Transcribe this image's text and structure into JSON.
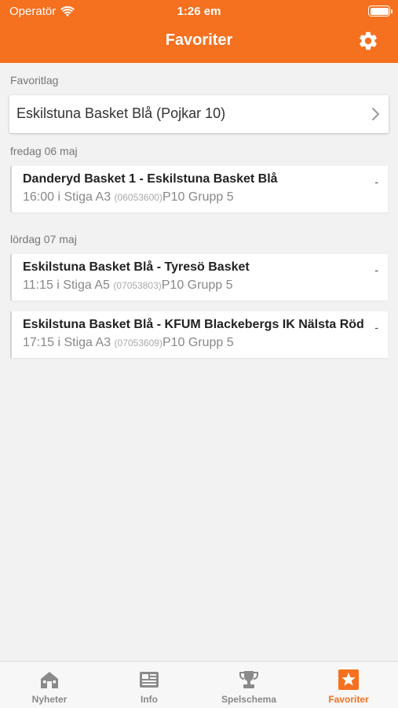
{
  "status_bar": {
    "carrier": "Operatör",
    "time": "1:26 em"
  },
  "header": {
    "title": "Favoriter"
  },
  "favorites": {
    "section_label": "Favoritlag",
    "team": "Eskilstuna Basket Blå (Pojkar 10)"
  },
  "days": [
    {
      "label": "fredag 06 maj",
      "matches": [
        {
          "teams": "Danderyd Basket 1 - Eskilstuna Basket Blå",
          "time_place": "16:00 i Stiga A3",
          "code": "(06053600)",
          "group": "P10 Grupp 5",
          "score": "-"
        }
      ]
    },
    {
      "label": "lördag 07 maj",
      "matches": [
        {
          "teams": "Eskilstuna Basket Blå - Tyresö Basket",
          "time_place": "11:15 i Stiga A5",
          "code": "(07053803)",
          "group": "P10 Grupp 5",
          "score": "-"
        },
        {
          "teams": "Eskilstuna Basket Blå - KFUM Blackebergs IK Nälsta Röd",
          "time_place": "17:15 i Stiga A3",
          "code": "(07053609)",
          "group": "P10 Grupp 5",
          "score": "-"
        }
      ]
    }
  ],
  "tabs": [
    {
      "label": "Nyheter",
      "icon": "house-icon",
      "active": false
    },
    {
      "label": "Info",
      "icon": "newspaper-icon",
      "active": false
    },
    {
      "label": "Spelschema",
      "icon": "trophy-icon",
      "active": false
    },
    {
      "label": "Favoriter",
      "icon": "star-icon",
      "active": true
    }
  ],
  "colors": {
    "accent": "#f5701f",
    "inactive_tab": "#888888"
  }
}
